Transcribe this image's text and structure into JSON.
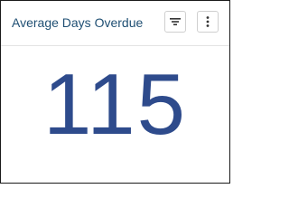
{
  "card": {
    "title": "Average Days Overdue",
    "value": "115",
    "toolbar": {
      "filter_icon": "filter-icon",
      "more_icon": "more-vertical-icon"
    }
  },
  "colors": {
    "title": "#1f4f73",
    "value": "#2e4b8c",
    "border": "#1a1a1a"
  }
}
